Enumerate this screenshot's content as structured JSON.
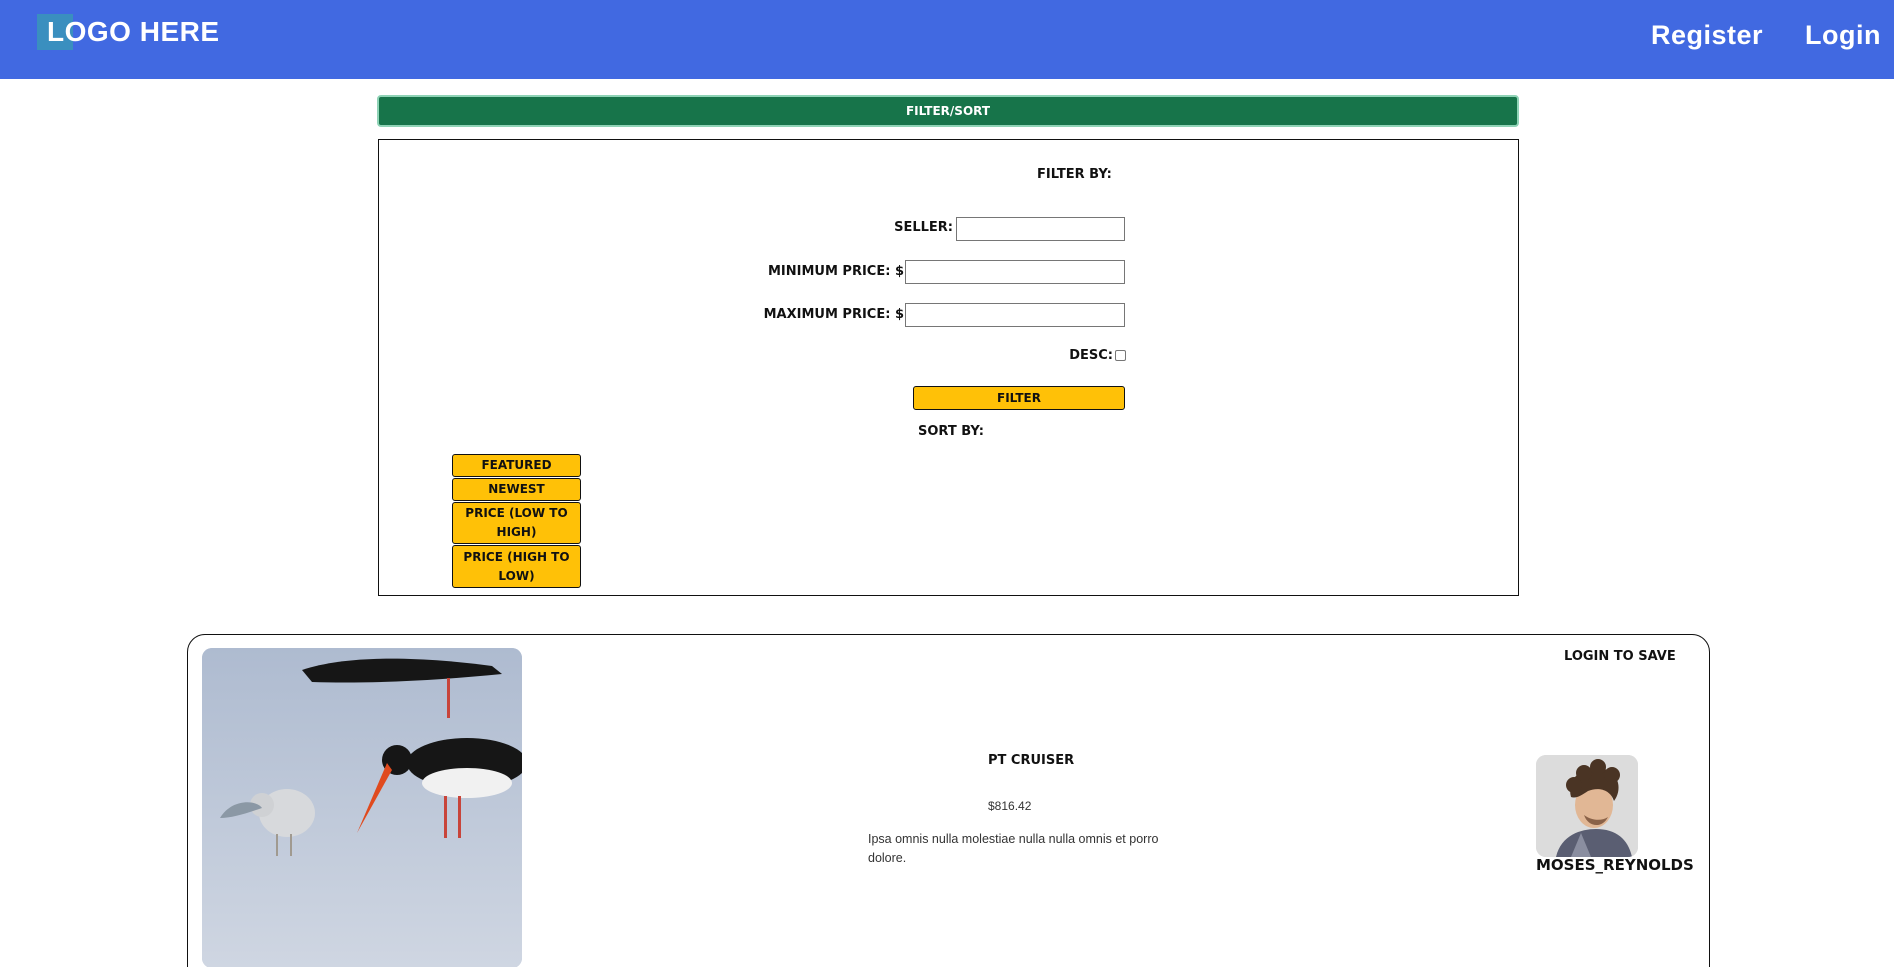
{
  "header": {
    "logo_text": "LOGO HERE",
    "nav": {
      "register": "Register",
      "login": "Login"
    }
  },
  "filter_toggle": {
    "label": "Filter/Sort"
  },
  "filter_panel": {
    "filter_heading": "Filter by:",
    "seller_label": "Seller:",
    "seller_value": "",
    "min_price_label": "Minimum Price: $",
    "min_price_value": "",
    "max_price_label": "Maximum Price: $",
    "max_price_value": "",
    "desc_label": "Desc:",
    "desc_checked": false,
    "filter_button": "Filter",
    "sort_heading": "Sort by:",
    "sort_options": [
      "Featured",
      "Newest",
      "Price (low to high)",
      "Price (high to low)"
    ]
  },
  "listing": {
    "save_label": "Login to save",
    "title": "PT Cruiser",
    "price": "$816.42",
    "description": "Ipsa omnis nulla molestiae nulla nulla omnis et porro dolore.",
    "seller_username": "moses_reynolds"
  },
  "colors": {
    "header_bg": "#4169e1",
    "filter_bar_bg": "#17744a",
    "button_bg": "#ffc107"
  }
}
